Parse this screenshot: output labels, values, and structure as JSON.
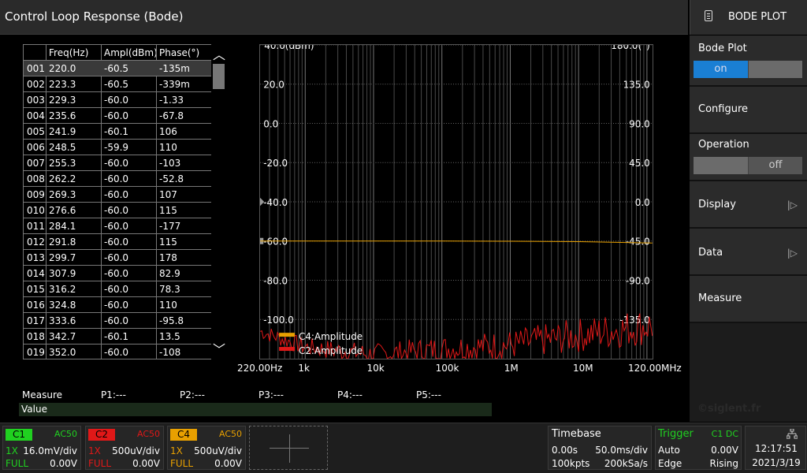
{
  "window": {
    "title": "Control Loop Response (Bode)"
  },
  "menu": {
    "header_label": "BODE PLOT",
    "header_icon": "document-icon",
    "bode_plot": {
      "label": "Bode Plot",
      "on": "on"
    },
    "configure": {
      "label": "Configure"
    },
    "operation": {
      "label": "Operation",
      "off": "off"
    },
    "display": {
      "label": "Display",
      "arrow": "|▷"
    },
    "data": {
      "label": "Data",
      "arrow": "|▷"
    },
    "measure": {
      "label": "Measure"
    }
  },
  "table": {
    "columns": [
      "",
      "Freq(Hz)",
      "Ampl(dBm)",
      "Phase(°)"
    ],
    "rows": [
      [
        "001",
        "220.0",
        "-60.5",
        "-135m"
      ],
      [
        "002",
        "223.3",
        "-60.5",
        "-339m"
      ],
      [
        "003",
        "229.3",
        "-60.0",
        "-1.33"
      ],
      [
        "004",
        "235.6",
        "-60.0",
        "-67.8"
      ],
      [
        "005",
        "241.9",
        "-60.1",
        "106"
      ],
      [
        "006",
        "248.5",
        "-59.9",
        "110"
      ],
      [
        "007",
        "255.3",
        "-60.0",
        "-103"
      ],
      [
        "008",
        "262.2",
        "-60.0",
        "-52.8"
      ],
      [
        "009",
        "269.3",
        "-60.0",
        "107"
      ],
      [
        "010",
        "276.6",
        "-60.0",
        "115"
      ],
      [
        "011",
        "284.1",
        "-60.0",
        "-177"
      ],
      [
        "012",
        "291.8",
        "-60.0",
        "115"
      ],
      [
        "013",
        "299.7",
        "-60.0",
        "178"
      ],
      [
        "014",
        "307.9",
        "-60.0",
        "82.9"
      ],
      [
        "015",
        "316.2",
        "-60.0",
        "78.3"
      ],
      [
        "016",
        "324.8",
        "-60.0",
        "110"
      ],
      [
        "017",
        "333.6",
        "-60.0",
        "-95.8"
      ],
      [
        "018",
        "342.7",
        "-60.1",
        "13.5"
      ],
      [
        "019",
        "352.0",
        "-60.0",
        "-108"
      ]
    ],
    "selected_row": 0
  },
  "chart_data": {
    "type": "line",
    "x_scale": "log",
    "xlim": [
      220,
      120000000
    ],
    "x_tick_labels": [
      "220.00Hz",
      "1k",
      "10k",
      "100k",
      "1M",
      "10M",
      "120.00MHz"
    ],
    "x_tick_values": [
      220,
      1000,
      10000,
      100000,
      1000000,
      10000000,
      120000000
    ],
    "ylim_left": [
      -120,
      40
    ],
    "y_left_ticks": [
      40,
      20,
      0,
      -20,
      -40,
      -60,
      -80,
      -100
    ],
    "y_left_tick_labels": [
      "40.0(dBm)",
      "20.0",
      "0.0",
      "-20.0",
      "-40.0",
      "-60.0",
      "-80.0",
      "-100.0"
    ],
    "ylim_right": [
      -180,
      180
    ],
    "y_right_ticks": [
      180,
      135,
      90,
      45,
      0,
      -45,
      -90,
      -135
    ],
    "y_right_tick_labels": [
      "180.0(°)",
      "135.0",
      "90.0",
      "45.0",
      "0.0",
      "-45.0",
      "-90.0",
      "-135.0"
    ],
    "series": [
      {
        "name": "C4:Amplitude",
        "color": "#e8a000",
        "x": [
          220,
          1000,
          10000,
          100000,
          1000000,
          10000000,
          120000000
        ],
        "values": [
          -60.0,
          -60.0,
          -60.0,
          -60.0,
          -60.1,
          -60.3,
          -61.0
        ]
      },
      {
        "name": "C2:Amplitude",
        "color": "#e01818",
        "x": [
          220,
          1000,
          10000,
          100000,
          1000000,
          10000000,
          120000000
        ],
        "values": [
          -106,
          -114,
          -118,
          -115,
          -113,
          -108,
          -103
        ]
      }
    ],
    "grid": true
  },
  "measure": {
    "title": "Measure",
    "p1": "P1:---",
    "p2": "P2:---",
    "p3": "P3:---",
    "p4": "P4:---",
    "p5": "P5:---",
    "value_label": "Value"
  },
  "watermark": "©siglent.fr",
  "channels": [
    {
      "tag": "C1",
      "coupling": "AC50",
      "probe": "1X",
      "scale": "16.0mV/div",
      "bw": "FULL",
      "offset": "0.00V",
      "color": "#20d020"
    },
    {
      "tag": "C2",
      "coupling": "AC50",
      "probe": "1X",
      "scale": "500uV/div",
      "bw": "FULL",
      "offset": "0.00V",
      "color": "#e01818"
    },
    {
      "tag": "C4",
      "coupling": "AC50",
      "probe": "1X",
      "scale": "500uV/div",
      "bw": "FULL",
      "offset": "0.00V",
      "color": "#e8a000"
    }
  ],
  "timebase": {
    "title": "Timebase",
    "delay": "0.00s",
    "scale": "50.0ms/div",
    "memory": "100kpts",
    "rate": "200kSa/s"
  },
  "trigger": {
    "title": "Trigger",
    "source": "C1 DC",
    "mode": "Auto",
    "level": "0.00V",
    "type": "Edge",
    "slope": "Rising"
  },
  "clock": {
    "time": "12:17:51",
    "date": "2021/3/19",
    "icon": "network-icon"
  }
}
